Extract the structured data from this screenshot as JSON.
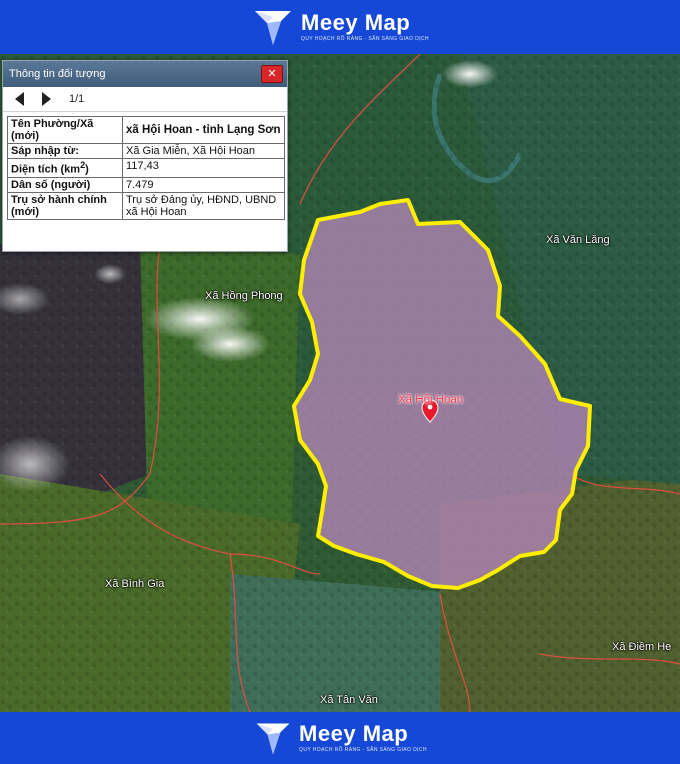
{
  "brand": {
    "name": "Meey Map",
    "tagline": "QUY HOẠCH RÕ RÀNG - SẴN SÀNG GIAO DỊCH"
  },
  "panel": {
    "title": "Thông tin đối tượng",
    "close_label": "✕",
    "pager": "1/1",
    "rows": [
      {
        "key": "Tên Phường/Xã (mới)",
        "value": "xã Hội Hoan - tỉnh Lạng Sơn"
      },
      {
        "key": "Sáp nhập từ:",
        "value": "Xã Gia Miễn, Xã Hội Hoan"
      },
      {
        "key_main": "Diện tích (km",
        "key_sup": "2",
        "key_end": ")",
        "value": "117,43"
      },
      {
        "key": "Dân số (người)",
        "value": "7.479"
      },
      {
        "key": "Trụ sở hành chính (mới)",
        "value": "Trụ sở Đảng ủy, HĐND, UBND xã Hội Hoan"
      }
    ]
  },
  "map": {
    "selected_label": "Xã Hội Hoan",
    "labels": [
      "Xã Văn Lăng",
      "Xã Hồng Phong",
      "Xã Bình Gia",
      "Xã Điềm He",
      "Xã Tân Văn"
    ],
    "colors": {
      "boundary": "#ffee00",
      "fill": "#b585b8",
      "marker": "#e8182c",
      "banner": "#1648d8"
    }
  }
}
